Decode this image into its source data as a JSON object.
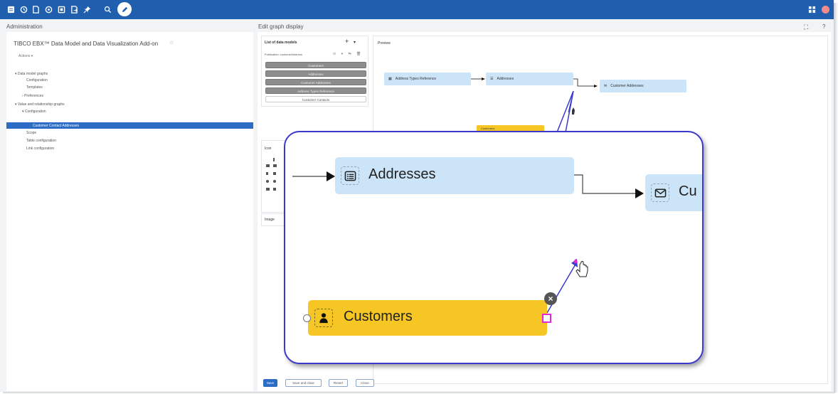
{
  "header": {
    "breadcrumb_left": "Administration",
    "breadcrumb_right": "Edit graph display",
    "toolbar_icons": [
      "database-icon",
      "clock-icon",
      "document-icon",
      "gauge-icon",
      "data-icon",
      "export-icon",
      "pin-icon",
      "search-icon",
      "pencil-icon"
    ],
    "right_icons": [
      "grid-icon",
      "avatar-icon"
    ],
    "fullscreen_glyph": "⛶",
    "help_glyph": "?"
  },
  "sidebar": {
    "title": "TIBCO EBX™ Data Model and Data Visualization Add-on",
    "star": "☆",
    "actions_label": "Actions ▾",
    "tree": [
      {
        "label": "▾ Data model graphs"
      },
      {
        "label": "Configuration"
      },
      {
        "label": "Templates"
      },
      {
        "label": "› Preferences"
      },
      {
        "label": "▾ Value and relationship graphs"
      },
      {
        "label": "▾ Configuration"
      },
      {
        "label": "Customer Contact Addresses",
        "selected": true
      },
      {
        "label": "Scope"
      },
      {
        "label": "Table configuration"
      },
      {
        "label": "Link configuration"
      }
    ]
  },
  "models_panel": {
    "title": "List of data models",
    "plus": "+",
    "caret": "▾",
    "publication": "Publication: customerAddress",
    "pub_icons": "⊙ ▾ ⇆ 🗑",
    "models": [
      {
        "label": "Customers",
        "state": "dark"
      },
      {
        "label": "Addresses",
        "state": "dark"
      },
      {
        "label": "Customer Addresses",
        "state": "dark"
      },
      {
        "label": "Address Types Reference",
        "state": "dark"
      },
      {
        "label": "Customer Contacts",
        "state": "light"
      }
    ]
  },
  "icon_panel": {
    "title": "Icon"
  },
  "image_panel": {
    "title": "Image"
  },
  "preview": {
    "title": "Preview",
    "nodes": [
      {
        "label": "Address Types Reference",
        "icon": "table-icon"
      },
      {
        "label": "Addresses",
        "icon": "list-icon"
      },
      {
        "label": "Customer Addresses",
        "icon": "mail-icon"
      },
      {
        "label": "Customers",
        "icon": "person-icon"
      }
    ]
  },
  "zoom": {
    "addresses_label": "Addresses",
    "customer_addresses_label": "Cu",
    "customers_label": "Customers",
    "close_glyph": "×"
  },
  "footer": {
    "save": "Save",
    "save_close": "Save and close",
    "revert": "Revert",
    "close": "Close"
  },
  "colors": {
    "topbar": "#1f5fae",
    "selected": "#2c6cc4",
    "node_blue": "#cce4f7",
    "node_yellow": "#f6c724",
    "callout": "#3b39c8",
    "link_handle": "#e32ad0"
  }
}
